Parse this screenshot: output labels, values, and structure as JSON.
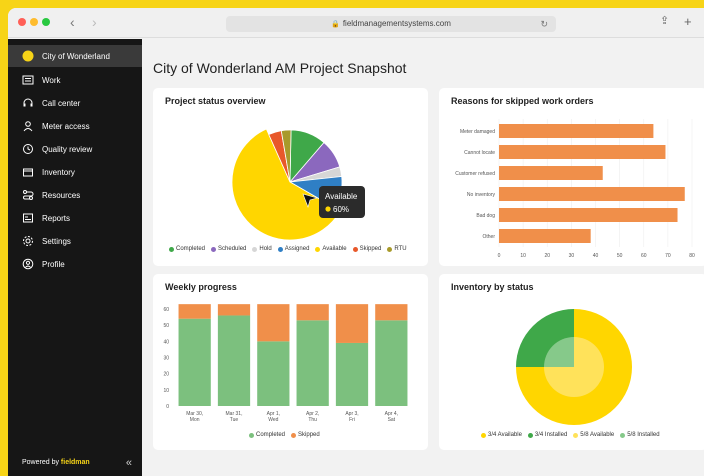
{
  "browser": {
    "url": "fieldmanagementsystems.com"
  },
  "sidebar": {
    "items": [
      {
        "label": "City of Wonderland",
        "icon": "yellow-circle-icon"
      },
      {
        "label": "Work",
        "icon": "list-icon"
      },
      {
        "label": "Call center",
        "icon": "headset-icon"
      },
      {
        "label": "Meter access",
        "icon": "key-person-icon"
      },
      {
        "label": "Quality review",
        "icon": "clock-check-icon"
      },
      {
        "label": "Inventory",
        "icon": "box-icon"
      },
      {
        "label": "Resources",
        "icon": "route-icon"
      },
      {
        "label": "Reports",
        "icon": "report-icon"
      },
      {
        "label": "Settings",
        "icon": "gear-icon"
      },
      {
        "label": "Profile",
        "icon": "user-icon"
      }
    ],
    "powered_by": "Powered by",
    "brand": "fieldman"
  },
  "page": {
    "title": "City of Wonderland AM Project Snapshot"
  },
  "cards": {
    "status_title": "Project status overview",
    "skipped_title": "Reasons for skipped work orders",
    "weekly_title": "Weekly progress",
    "inventory_title": "Inventory by status"
  },
  "tooltip": {
    "label": "Available",
    "value": "60%"
  },
  "colors": {
    "accent": "#f7d417",
    "completed": "#3fa849",
    "scheduled": "#8b68be",
    "hold": "#d6d6d6",
    "assigned": "#2f7fc5",
    "available": "#ffd600",
    "skipped": "#e8582a",
    "rtu": "#a89a2a",
    "bar_orange": "#f08f4a",
    "weekly_green": "#7cc07e"
  },
  "chart_data": [
    {
      "type": "pie",
      "title": "Project status overview",
      "labels": [
        "Completed",
        "Scheduled",
        "Hold",
        "Assigned",
        "Available",
        "Skipped",
        "RTU"
      ],
      "values": [
        11,
        9,
        3,
        10,
        60,
        4,
        3
      ]
    },
    {
      "type": "bar",
      "orientation": "horizontal",
      "title": "Reasons for skipped work orders",
      "categories": [
        "Meter damaged",
        "Cannot locate",
        "Customer refused",
        "No inventory",
        "Bad dog",
        "Other"
      ],
      "values": [
        64,
        69,
        43,
        77,
        74,
        38
      ],
      "xlim": [
        0,
        80
      ],
      "xticks": [
        "0",
        "10",
        "20",
        "30",
        "40",
        "50",
        "60",
        "70",
        "80"
      ]
    },
    {
      "type": "bar",
      "stacked": true,
      "title": "Weekly progress",
      "categories": [
        [
          "Mar 30,",
          "Mon"
        ],
        [
          "Mar 31,",
          "Tue"
        ],
        [
          "Apr 1,",
          "Wed"
        ],
        [
          "Apr 2,",
          "Thu"
        ],
        [
          "Apr 3,",
          "Fri"
        ],
        [
          "Apr 4,",
          "Sat"
        ]
      ],
      "series": [
        {
          "name": "Completed",
          "values": [
            54,
            56,
            40,
            53,
            39,
            53
          ]
        },
        {
          "name": "Skipped",
          "values": [
            9,
            7,
            23,
            10,
            24,
            10
          ]
        }
      ],
      "ylim": [
        0,
        60
      ],
      "yticks": [
        "0",
        "10",
        "20",
        "30",
        "40",
        "50",
        "60"
      ]
    },
    {
      "type": "pie",
      "title": "Inventory by status",
      "rings": [
        {
          "labels": [
            "3/4 Available",
            "3/4 Installed"
          ],
          "values": [
            75,
            25
          ]
        },
        {
          "labels": [
            "5/8 Available",
            "5/8 Installed"
          ],
          "values": [
            75,
            25
          ]
        }
      ],
      "legend": [
        "3/4 Available",
        "3/4 Installed",
        "5/8 Available",
        "5/8 Installed"
      ],
      "legend_colors": [
        "#ffd600",
        "#3fa849",
        "#ffe25a",
        "#86c98a"
      ]
    }
  ]
}
